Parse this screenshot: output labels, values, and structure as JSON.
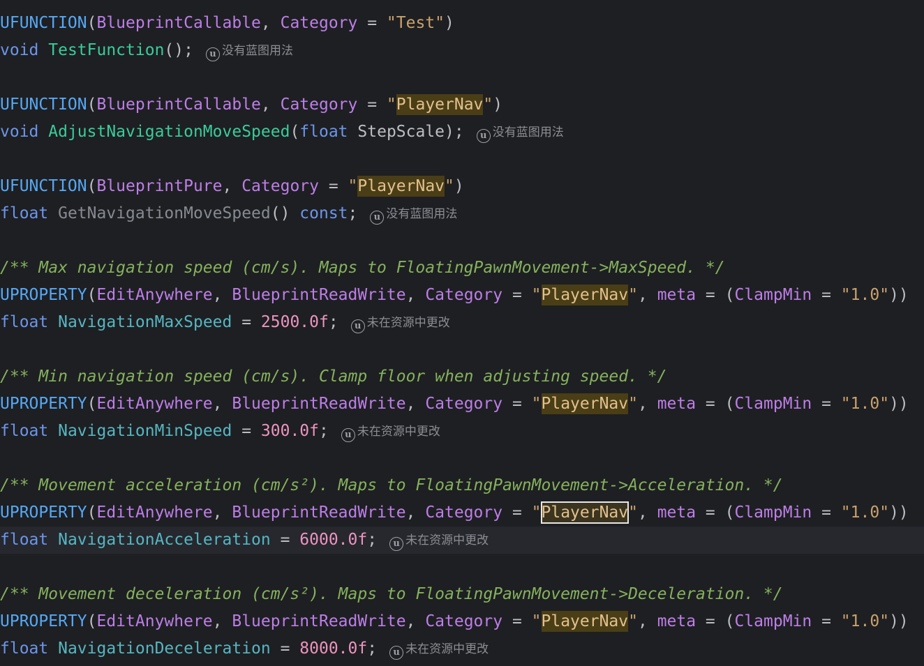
{
  "hint_icon": "unreal-u-icon",
  "hints": {
    "no_usage": "没有蓝图用法",
    "not_changed": "未在资源中更改"
  },
  "lines": {
    "l0_macro": "UFUNCTION",
    "l0_spec": "BlueprintCallable",
    "l0_cat": "Category",
    "l0_str": "Test",
    "l1_type": "void",
    "l1_name": "TestFunction",
    "l3_macro": "UFUNCTION",
    "l3_spec": "BlueprintCallable",
    "l3_cat": "Category",
    "l3_str": "PlayerNav",
    "l4_type": "void",
    "l4_name": "AdjustNavigationMoveSpeed",
    "l4_ptype": "float",
    "l4_param": "StepScale",
    "l6_macro": "UFUNCTION",
    "l6_spec": "BlueprintPure",
    "l6_cat": "Category",
    "l6_str": "PlayerNav",
    "l7_type": "float",
    "l7_name": "GetNavigationMoveSpeed",
    "l7_const": "const",
    "c9": "/** Max navigation speed (cm/s). Maps to FloatingPawnMovement->MaxSpeed. */",
    "c13": "/** Min navigation speed (cm/s). Clamp floor when adjusting speed. */",
    "c17": "/** Movement acceleration (cm/s²). Maps to FloatingPawnMovement->Acceleration. */",
    "c21": "/** Movement deceleration (cm/s²). Maps to FloatingPawnMovement->Deceleration. */",
    "uprop": "UPROPERTY",
    "edit": "EditAnywhere",
    "brw": "BlueprintReadWrite",
    "cat": "Category",
    "catval": "PlayerNav",
    "meta": "meta",
    "clamp": "ClampMin",
    "clampval": "1.0",
    "float": "float",
    "v11_name": "NavigationMaxSpeed",
    "v11_val": "2500.0f",
    "v15_name": "NavigationMinSpeed",
    "v15_val": "300.0f",
    "v19_name": "NavigationAcceleration",
    "v19_val": "6000.0f",
    "v23_name": "NavigationDeceleration",
    "v23_val": "8000.0f"
  },
  "colors": {
    "background": "#1e1f22",
    "current_line": "#26282e",
    "highlight": "#4a3e16",
    "comment": "#85b25e",
    "number": "#ed94c0",
    "string": "#c9a26d"
  }
}
